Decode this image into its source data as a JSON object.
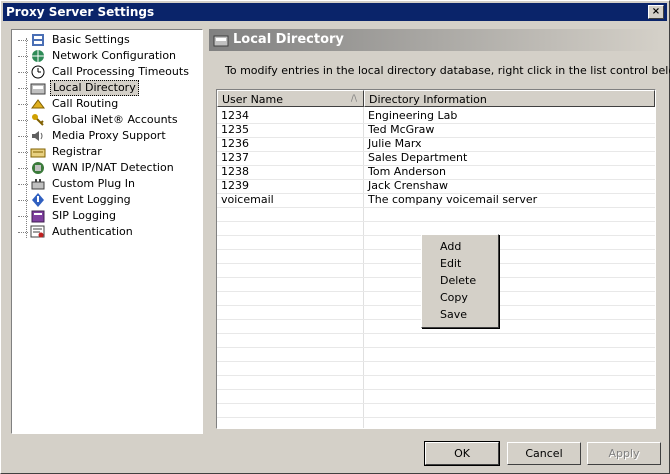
{
  "window": {
    "title": "Proxy Server Settings",
    "close_label": "×"
  },
  "tree": {
    "items": [
      {
        "label": "Basic Settings",
        "icon": "settings-icon"
      },
      {
        "label": "Network Configuration",
        "icon": "globe-icon"
      },
      {
        "label": "Call Processing Timeouts",
        "icon": "clock-icon"
      },
      {
        "label": "Local Directory",
        "icon": "directory-icon",
        "selected": true
      },
      {
        "label": "Call Routing",
        "icon": "routing-icon"
      },
      {
        "label": "Global iNet® Accounts",
        "icon": "key-icon"
      },
      {
        "label": "Media Proxy Support",
        "icon": "speaker-icon"
      },
      {
        "label": "Registrar",
        "icon": "registrar-icon"
      },
      {
        "label": "WAN IP/NAT Detection",
        "icon": "network-icon"
      },
      {
        "label": "Custom Plug In",
        "icon": "plugin-icon"
      },
      {
        "label": "Event Logging",
        "icon": "event-icon"
      },
      {
        "label": "SIP Logging",
        "icon": "book-icon"
      },
      {
        "label": "Authentication",
        "icon": "certificate-icon"
      }
    ]
  },
  "panel": {
    "title": "Local Directory",
    "instruction": "To modify entries in the local directory database, right click in the list control below.",
    "columns": [
      "User Name",
      "Directory Information"
    ],
    "rows": [
      [
        "1234",
        "Engineering Lab"
      ],
      [
        "1235",
        "Ted McGraw"
      ],
      [
        "1236",
        "Julie Marx"
      ],
      [
        "1237",
        "Sales Department"
      ],
      [
        "1238",
        "Tom Anderson"
      ],
      [
        "1239",
        "Jack Crenshaw"
      ],
      [
        "voicemail",
        "The company voicemail server"
      ]
    ]
  },
  "context_menu": {
    "items": [
      "Add",
      "Edit",
      "Delete",
      "Copy",
      "Save"
    ]
  },
  "buttons": {
    "ok": "OK",
    "cancel": "Cancel",
    "apply": "Apply"
  }
}
